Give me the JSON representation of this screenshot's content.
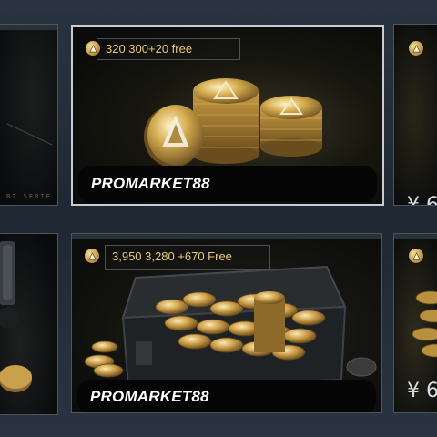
{
  "colors": {
    "background": "#243039",
    "gold": "#e8c77c",
    "card_border": "#4a5563",
    "selected_border": "#c9cdd2"
  },
  "cards": {
    "top_left": {
      "brand_fragment": "B2 SERIE"
    },
    "top_center": {
      "amount": "320 300+20 free",
      "brand": "PROMARKET88",
      "icon": "coin-triangle-icon"
    },
    "top_right": {
      "price": "¥ 6"
    },
    "bottom_left": {},
    "bottom_center": {
      "amount": "3,950 3,280 +670 Free",
      "brand": "PROMARKET88",
      "icon": "coin-triangle-icon"
    },
    "bottom_right": {
      "price": "¥ 6"
    }
  }
}
